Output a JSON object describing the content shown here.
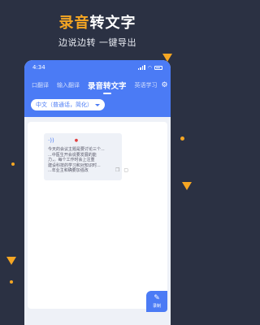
{
  "hero": {
    "title_highlight": "录音",
    "title_rest": "转文字",
    "subtitle": "边说边转  一键导出"
  },
  "status_bar": {
    "time": "4:34"
  },
  "tabs": [
    {
      "label": "口翻译"
    },
    {
      "label": "输入翻译"
    },
    {
      "label": "录音转文字"
    },
    {
      "label": "英语学习"
    }
  ],
  "language_select": {
    "value": "中文（普通话，简化）"
  },
  "transcript": {
    "lines": [
      "今天的会议主题是要讨论三个...",
      "...中医生开会说要发展的能",
      "力，。每个工作时会上注重",
      "建设科技的学习和对知识时...",
      "...年业主和确要加强改"
    ]
  },
  "fab": {
    "label": "录制"
  },
  "colors": {
    "accent": "#f5a623",
    "brand": "#4b7bf5",
    "background": "#2b3143"
  },
  "icons": [
    "gear-icon",
    "sound-wave-icon",
    "mic-icon",
    "copy-icon",
    "delete-icon",
    "record-icon",
    "chevron-down-icon"
  ]
}
